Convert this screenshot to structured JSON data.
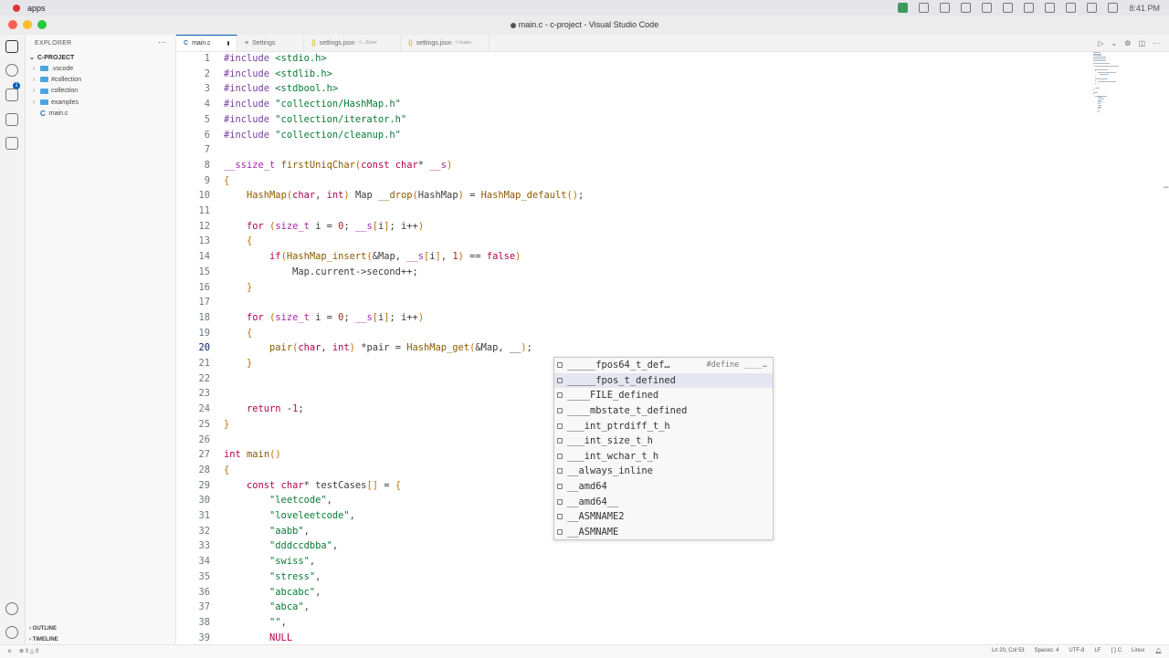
{
  "system_bar": {
    "app_label": "apps",
    "time": "8:41 PM"
  },
  "window": {
    "title": "main.c - c-project - Visual Studio Code"
  },
  "sidebar": {
    "header": "EXPLORER",
    "project": "C-PROJECT",
    "items": [
      {
        "label": ".vscode"
      },
      {
        "label": "#collection"
      },
      {
        "label": "collection"
      },
      {
        "label": "examples"
      },
      {
        "label": "main.c"
      }
    ],
    "outline": "OUTLINE",
    "timeline": "TIMELINE",
    "badge": "1"
  },
  "tabs": [
    {
      "label": "main.c",
      "sub": ""
    },
    {
      "label": "Settings",
      "sub": ""
    },
    {
      "label": "settings.json",
      "sub": "~/.../User"
    },
    {
      "label": "settings.json",
      "sub": "~/.make"
    }
  ],
  "editor": {
    "current_line": 20,
    "lines": [
      {
        "n": "1",
        "text": "#include <stdio.h>"
      },
      {
        "n": "2",
        "text": "#include <stdlib.h>"
      },
      {
        "n": "3",
        "text": "#include <stdbool.h>"
      },
      {
        "n": "4",
        "text": "#include \"collection/HashMap.h\""
      },
      {
        "n": "5",
        "text": "#include \"collection/iterator.h\""
      },
      {
        "n": "6",
        "text": "#include \"collection/cleanup.h\""
      },
      {
        "n": "7",
        "text": ""
      },
      {
        "n": "8",
        "text": "__ssize_t firstUniqChar(const char* __s)"
      },
      {
        "n": "9",
        "text": "{"
      },
      {
        "n": "10",
        "text": "    HashMap(char, int) Map __drop(HashMap) = HashMap_default();"
      },
      {
        "n": "11",
        "text": ""
      },
      {
        "n": "12",
        "text": "    for (size_t i = 0; __s[i]; i++)"
      },
      {
        "n": "13",
        "text": "    {"
      },
      {
        "n": "14",
        "text": "        if(HashMap_insert(&Map, __s[i], 1) == false)"
      },
      {
        "n": "15",
        "text": "            Map.current->second++;"
      },
      {
        "n": "16",
        "text": "    }"
      },
      {
        "n": "17",
        "text": ""
      },
      {
        "n": "18",
        "text": "    for (size_t i = 0; __s[i]; i++)"
      },
      {
        "n": "19",
        "text": "    {"
      },
      {
        "n": "20",
        "text": "        pair(char, int) *pair = HashMap_get(&Map, __);"
      },
      {
        "n": "21",
        "text": "    }"
      },
      {
        "n": "22",
        "text": ""
      },
      {
        "n": "23",
        "text": ""
      },
      {
        "n": "24",
        "text": "    return -1;"
      },
      {
        "n": "25",
        "text": "}"
      },
      {
        "n": "26",
        "text": ""
      },
      {
        "n": "27",
        "text": "int main()"
      },
      {
        "n": "28",
        "text": "{"
      },
      {
        "n": "29",
        "text": "    const char* testCases[] = {"
      },
      {
        "n": "30",
        "text": "        \"leetcode\","
      },
      {
        "n": "31",
        "text": "        \"loveleetcode\","
      },
      {
        "n": "32",
        "text": "        \"aabb\","
      },
      {
        "n": "33",
        "text": "        \"dddccdbba\","
      },
      {
        "n": "34",
        "text": "        \"swiss\","
      },
      {
        "n": "35",
        "text": "        \"stress\","
      },
      {
        "n": "36",
        "text": "        \"abcabc\","
      },
      {
        "n": "37",
        "text": "        \"abca\","
      },
      {
        "n": "38",
        "text": "        \"\","
      },
      {
        "n": "39",
        "text": "        NULL"
      }
    ]
  },
  "autocomplete": {
    "items": [
      {
        "label": "_____fpos64_t_def…",
        "detail": "#define ____…"
      },
      {
        "label": "_____fpos_t_defined",
        "detail": ""
      },
      {
        "label": "____FILE_defined",
        "detail": ""
      },
      {
        "label": "____mbstate_t_defined",
        "detail": ""
      },
      {
        "label": "___int_ptrdiff_t_h",
        "detail": ""
      },
      {
        "label": "___int_size_t_h",
        "detail": ""
      },
      {
        "label": "___int_wchar_t_h",
        "detail": ""
      },
      {
        "label": "__always_inline",
        "detail": ""
      },
      {
        "label": "__amd64",
        "detail": ""
      },
      {
        "label": "__amd64__",
        "detail": ""
      },
      {
        "label": "__ASMNAME2",
        "detail": ""
      },
      {
        "label": "__ASMNAME",
        "detail": ""
      }
    ]
  },
  "statusbar": {
    "errors": "0",
    "warnings": "0",
    "position": "Ln 20, Col 53",
    "spaces": "Spaces: 4",
    "encoding": "UTF-8",
    "eol": "LF",
    "language": "C",
    "platform": "Linux"
  }
}
